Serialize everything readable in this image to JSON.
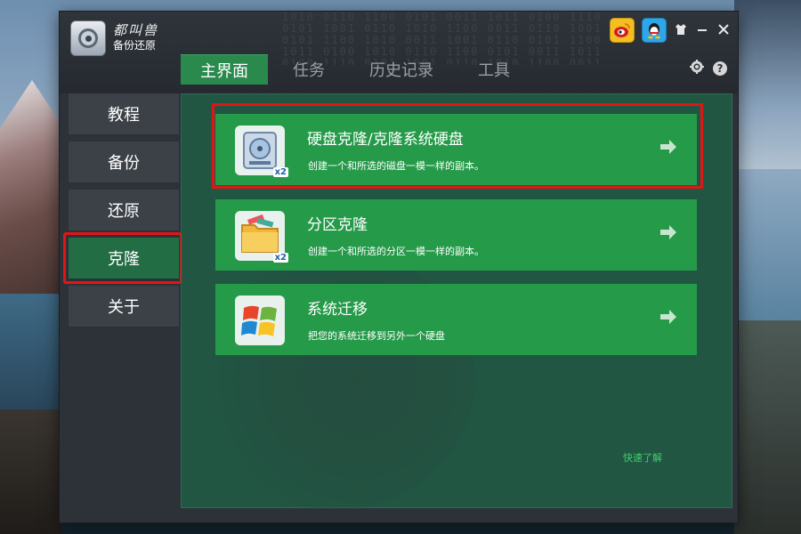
{
  "app": {
    "brand_top": "都叫兽",
    "brand_sub": "备份还原"
  },
  "tabs": [
    {
      "label": "主界面",
      "active": true
    },
    {
      "label": "任务",
      "active": false
    },
    {
      "label": "历史记录",
      "active": false
    },
    {
      "label": "工具",
      "active": false
    }
  ],
  "title_icons": {
    "weibo": "weibo-icon",
    "qq": "qq-icon",
    "skin": "shirt-icon",
    "minimize": "minimize-icon",
    "close": "close-icon",
    "settings": "gear-icon",
    "help": "help-icon"
  },
  "sidebar": {
    "items": [
      {
        "label": "教程",
        "active": false
      },
      {
        "label": "备份",
        "active": false
      },
      {
        "label": "还原",
        "active": false
      },
      {
        "label": "克隆",
        "active": true
      },
      {
        "label": "关于",
        "active": false
      }
    ]
  },
  "cards": [
    {
      "title": "硬盘克隆/克隆系统硬盘",
      "desc": "创建一个和所选的磁盘一模一样的副本。",
      "icon": "hard-disk-icon",
      "badge": "x2"
    },
    {
      "title": "分区克隆",
      "desc": "创建一个和所选的分区一模一样的副本。",
      "icon": "folder-icon",
      "badge": "x2"
    },
    {
      "title": "系统迁移",
      "desc": "把您的系统迁移到另外一个硬盘",
      "icon": "windows-logo-icon",
      "badge": ""
    }
  ],
  "quick_link": "快速了解",
  "colors": {
    "accent_green": "#259a49",
    "active_tab": "#2a8a4d",
    "highlight_red": "#e01616"
  }
}
